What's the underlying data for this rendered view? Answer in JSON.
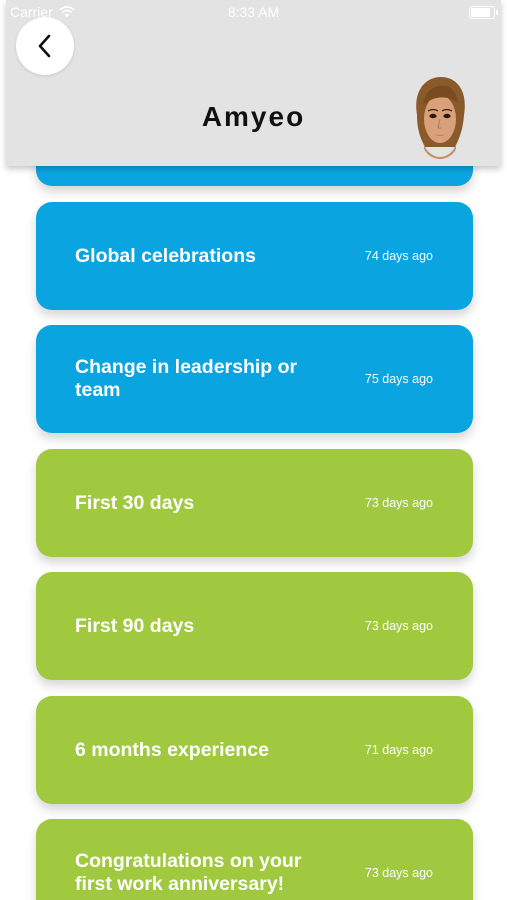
{
  "status_bar": {
    "carrier": "Carrier",
    "time": "8:33 AM"
  },
  "header": {
    "title": "Amyeo"
  },
  "cards": [
    {
      "title": "Global celebrations",
      "time": "74 days ago",
      "color": "#0aa5e0"
    },
    {
      "title": "Change in leadership or team",
      "time": "75 days ago",
      "color": "#0aa5e0"
    },
    {
      "title": "First 30 days",
      "time": "73 days ago",
      "color": "#a0c940"
    },
    {
      "title": "First 90 days",
      "time": "73 days ago",
      "color": "#a0c940"
    },
    {
      "title": "6 months experience",
      "time": "71 days ago",
      "color": "#a0c940"
    },
    {
      "title": "Congratulations on your first work anniversary!",
      "time": "73 days ago",
      "color": "#a0c940"
    }
  ],
  "icons": {
    "back": "chevron-left-icon",
    "wifi": "wifi-icon",
    "battery": "battery-icon",
    "avatar": "avatar"
  },
  "colors": {
    "header_bg": "#e3e3e3",
    "blue_card": "#0aa5e0",
    "green_card": "#a0c940"
  }
}
